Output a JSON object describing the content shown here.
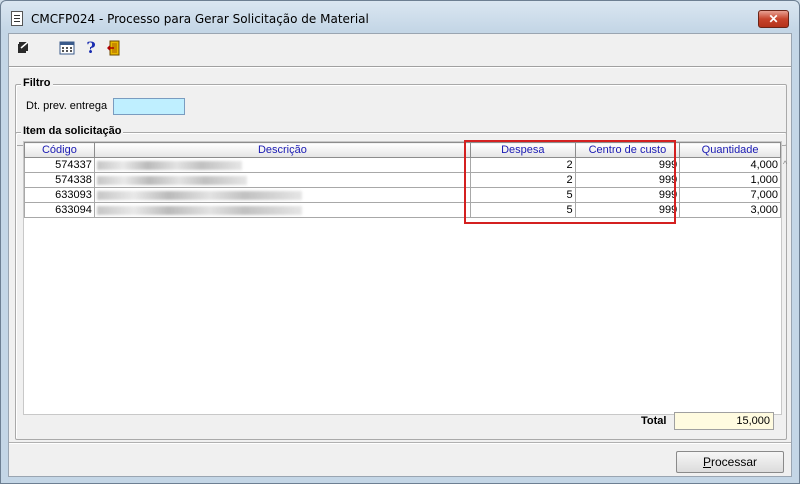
{
  "window": {
    "title": "CMCFP024 - Processo para Gerar Solicitação de Material",
    "close_label": "✕"
  },
  "toolbar": {
    "icons": [
      "arrow-icon",
      "calculator-icon",
      "help-icon",
      "exit-icon"
    ],
    "help_glyph": "?"
  },
  "filtro": {
    "label": "Filtro",
    "dt_label": "Dt. prev. entrega",
    "dt_value": ""
  },
  "itens": {
    "label": "Item da solicitação",
    "columns": [
      "Código",
      "Descrição",
      "Despesa",
      "Centro de custo",
      "Quantidade"
    ],
    "rows": [
      {
        "codigo": "574337",
        "despesa": "2",
        "centro": "999",
        "quantidade": "4,000"
      },
      {
        "codigo": "574338",
        "despesa": "2",
        "centro": "999",
        "quantidade": "1,000"
      },
      {
        "codigo": "633093",
        "despesa": "5",
        "centro": "999",
        "quantidade": "7,000"
      },
      {
        "codigo": "633094",
        "despesa": "5",
        "centro": "999",
        "quantidade": "3,000"
      }
    ]
  },
  "total": {
    "label": "Total",
    "value": "15,000"
  },
  "actions": {
    "processar_first": "P",
    "processar_rest": "rocessar"
  },
  "colors": {
    "highlight": "#d42020",
    "header_text": "#1a1ab3",
    "input_bg": "#bfefff",
    "total_bg": "#fffbe0"
  }
}
